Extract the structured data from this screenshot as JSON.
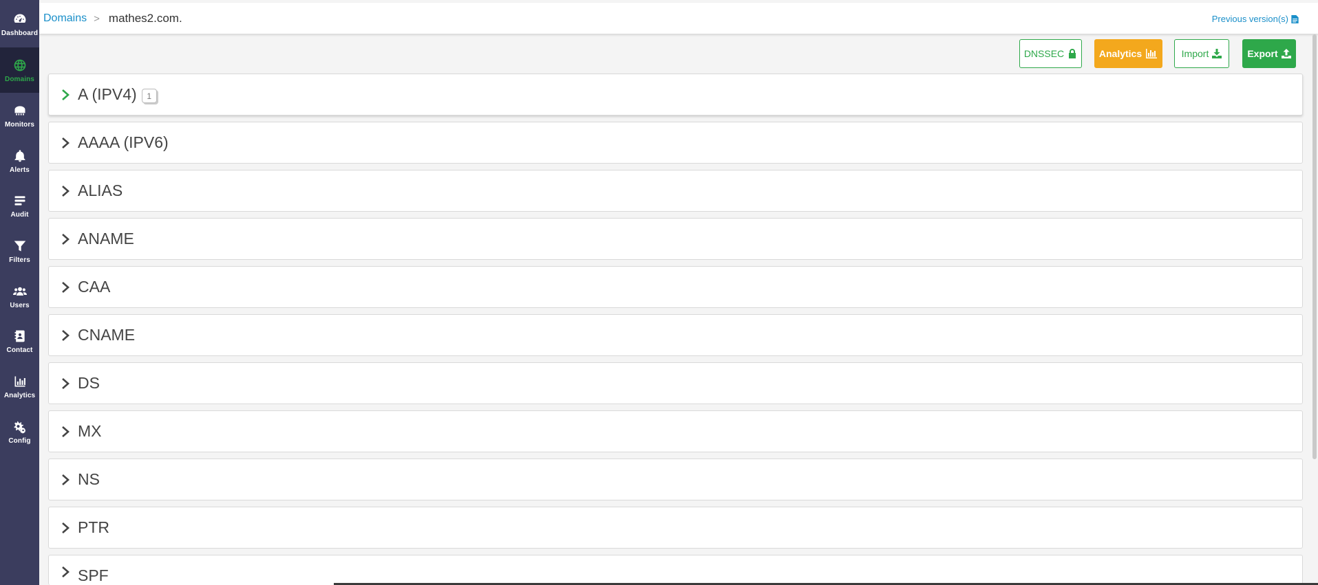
{
  "sidebar": {
    "items": [
      {
        "label": "Dashboard",
        "icon": "dashboard-icon",
        "active": false
      },
      {
        "label": "Domains",
        "icon": "globe-icon",
        "active": true
      },
      {
        "label": "Monitors",
        "icon": "monitor-icon",
        "active": false
      },
      {
        "label": "Alerts",
        "icon": "bell-icon",
        "active": false
      },
      {
        "label": "Audit",
        "icon": "audit-list-icon",
        "active": false
      },
      {
        "label": "Filters",
        "icon": "filter-icon",
        "active": false
      },
      {
        "label": "Users",
        "icon": "users-icon",
        "active": false
      },
      {
        "label": "Contact",
        "icon": "contact-icon",
        "active": false
      },
      {
        "label": "Analytics",
        "icon": "bar-chart-icon",
        "active": false
      },
      {
        "label": "Config",
        "icon": "gears-icon",
        "active": false
      }
    ]
  },
  "header": {
    "breadcrumb_root": "Domains",
    "breadcrumb_separator": ">",
    "domain": "mathes2.com.",
    "previous_versions": "Previous version(s)"
  },
  "toolbar": {
    "dnssec": "DNSSEC",
    "analytics": "Analytics",
    "import": "Import",
    "export": "Export"
  },
  "records": [
    {
      "type": "A (IPV4)",
      "count": "1"
    },
    {
      "type": "AAAA (IPV6)"
    },
    {
      "type": "ALIAS"
    },
    {
      "type": "ANAME"
    },
    {
      "type": "CAA"
    },
    {
      "type": "CNAME"
    },
    {
      "type": "DS"
    },
    {
      "type": "MX"
    },
    {
      "type": "NS"
    },
    {
      "type": "PTR"
    },
    {
      "type": "SPF"
    }
  ],
  "colors": {
    "sidebar_bg": "#3b3d5e",
    "sidebar_active_bg": "#22243b",
    "accent_green": "#2ea84a",
    "accent_orange": "#f3a81d",
    "link_blue": "#1a8fc9"
  }
}
